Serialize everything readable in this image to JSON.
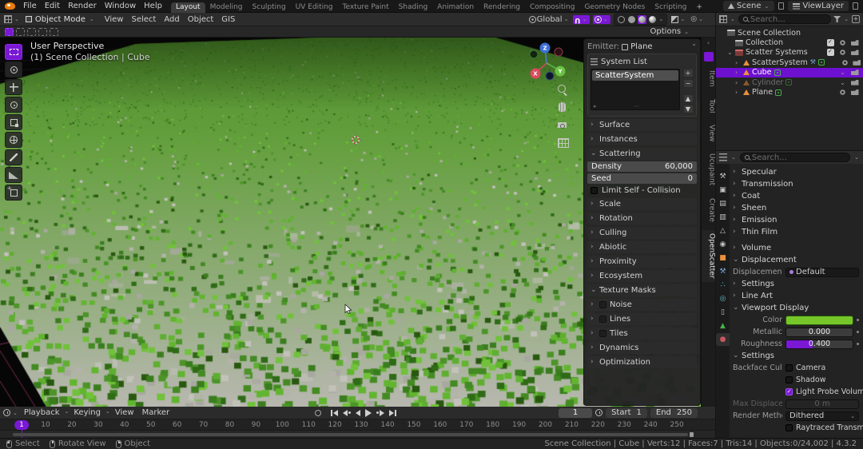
{
  "topbar": {
    "menus": [
      "File",
      "Edit",
      "Render",
      "Window",
      "Help"
    ],
    "workspaces": [
      "Layout",
      "Modeling",
      "Sculpting",
      "UV Editing",
      "Texture Paint",
      "Shading",
      "Animation",
      "Rendering",
      "Compositing",
      "Geometry Nodes",
      "Scripting"
    ],
    "active_workspace": "Layout",
    "add_workspace": "+",
    "scene_label": "Scene",
    "viewlayer_label": "ViewLayer"
  },
  "viewport": {
    "header": {
      "mode": "Object Mode",
      "menus": [
        "View",
        "Select",
        "Add",
        "Object",
        "GIS"
      ],
      "orientation": "Global"
    },
    "tool_settings": {
      "options_label": "Options",
      "select_modes": [
        "select-mode-new",
        "select-mode-extend",
        "select-mode-subtract",
        "select-mode-invert",
        "select-mode-intersect"
      ]
    },
    "overlay": {
      "line1": "User Perspective",
      "line2": "(1) Scene Collection | Cube"
    },
    "tools": [
      "select-box",
      "cursor",
      "move",
      "rotate",
      "scale",
      "transform",
      "annotate",
      "measure",
      "add-cube"
    ],
    "gizmo_axes": [
      "X",
      "Y",
      "Z"
    ],
    "sidebar_tabs": [
      "Item",
      "Tool",
      "View",
      "Ucupaint",
      "Create",
      "OpenScatter"
    ],
    "active_sidebar_tab": "OpenScatter",
    "field_palette": {
      "greens": [
        "#3a7d1e",
        "#4c9428",
        "#5fae31",
        "#70c23a",
        "#438a22",
        "#61b52f",
        "#2f6b16"
      ],
      "grays": [
        "#b3b3aa",
        "#c2c2ba",
        "#a8a8a0"
      ],
      "sky": "#060606",
      "ground_top": "#4f8f2a",
      "ground_mid": "#66a040",
      "ground_bottom": "#b8b8b0"
    }
  },
  "scatter_panel": {
    "emitter_label": "Emitter:",
    "emitter_value": "Plane",
    "system_list_title": "System List",
    "systems": [
      "ScatterSystem"
    ],
    "selected_system": "ScatterSystem",
    "rows": [
      {
        "type": "section",
        "label": "Surface"
      },
      {
        "type": "section",
        "label": "Instances"
      },
      {
        "type": "section_open",
        "label": "Scattering"
      },
      {
        "type": "slider",
        "label": "Density",
        "value": "60,000"
      },
      {
        "type": "slider",
        "label": "Seed",
        "value": "0"
      },
      {
        "type": "check",
        "label": "Limit Self - Collision",
        "checked": false
      },
      {
        "type": "section",
        "label": "Scale"
      },
      {
        "type": "section",
        "label": "Rotation"
      },
      {
        "type": "section",
        "label": "Culling"
      },
      {
        "type": "section",
        "label": "Abiotic"
      },
      {
        "type": "section",
        "label": "Proximity"
      },
      {
        "type": "section",
        "label": "Ecosystem"
      },
      {
        "type": "section_open",
        "label": "Texture Masks"
      },
      {
        "type": "subcheck",
        "label": "Noise",
        "checked": false
      },
      {
        "type": "subcheck",
        "label": "Lines",
        "checked": false
      },
      {
        "type": "subcheck",
        "label": "Tiles",
        "checked": false
      },
      {
        "type": "section",
        "label": "Dynamics"
      },
      {
        "type": "section",
        "label": "Optimization"
      }
    ]
  },
  "outliner": {
    "search_placeholder": "Search...",
    "rows": [
      {
        "label": "Scene Collection",
        "icon": "scene-collection",
        "depth": 0,
        "right": []
      },
      {
        "label": "Collection",
        "icon": "collection",
        "depth": 1,
        "right": [
          "check",
          "eye",
          "camera"
        ]
      },
      {
        "label": "Scatter Systems",
        "icon": "collection-red",
        "depth": 1,
        "caret": "open",
        "right": [
          "check",
          "eye",
          "camera"
        ]
      },
      {
        "label": "ScatterSystem",
        "icon": "mesh",
        "depth": 2,
        "caret": "closed",
        "extras": [
          "wrench",
          "nodes"
        ],
        "right": [
          "eye",
          "camera"
        ]
      },
      {
        "label": "Cube",
        "icon": "mesh",
        "depth": 2,
        "caret": "closed",
        "extras": [
          "nodes"
        ],
        "selected": true,
        "right": [
          "chevron",
          "camera"
        ]
      },
      {
        "label": "Cylinder",
        "icon": "mesh",
        "depth": 2,
        "caret": "closed",
        "extras": [
          "nodes"
        ],
        "dim": true,
        "right": [
          "chevron",
          "camera"
        ]
      },
      {
        "label": "Plane",
        "icon": "mesh",
        "depth": 2,
        "caret": "closed",
        "extras": [
          "nodes"
        ],
        "right": [
          "eye",
          "camera"
        ]
      }
    ]
  },
  "properties": {
    "search_placeholder": "Search...",
    "tabs": [
      "tool",
      "render",
      "output",
      "view-layer",
      "scene",
      "world",
      "object",
      "modifiers",
      "particles",
      "physics",
      "constraints",
      "object-data",
      "material"
    ],
    "active_tab": "material",
    "rows": [
      {
        "type": "section",
        "label": "Specular"
      },
      {
        "type": "section",
        "label": "Transmission"
      },
      {
        "type": "section",
        "label": "Coat"
      },
      {
        "type": "section",
        "label": "Sheen"
      },
      {
        "type": "section",
        "label": "Emission"
      },
      {
        "type": "section",
        "label": "Thin Film"
      },
      {
        "type": "section",
        "label": "Volume",
        "gap": true
      },
      {
        "type": "section_open",
        "label": "Displacement"
      },
      {
        "type": "field",
        "label": "Displacement",
        "value": "Default",
        "dot": true
      },
      {
        "type": "section",
        "label": "Settings"
      },
      {
        "type": "section",
        "label": "Line Art"
      },
      {
        "type": "section_open",
        "label": "Viewport Display"
      },
      {
        "type": "color",
        "label": "Color",
        "value": "#76c62a"
      },
      {
        "type": "slider",
        "label": "Metallic",
        "value": "0.000",
        "fill": 0
      },
      {
        "type": "slider",
        "label": "Roughness",
        "value": "0.400",
        "fill": 0.4
      },
      {
        "type": "section_open",
        "label": "Settings"
      },
      {
        "type": "checkrow",
        "label": "Backface Culling",
        "check": "Camera",
        "checked": false
      },
      {
        "type": "checkrow",
        "label": "",
        "check": "Shadow",
        "checked": false
      },
      {
        "type": "checkrow",
        "label": "",
        "check": "Light Probe Volume",
        "checked": true
      },
      {
        "type": "field_dim",
        "label": "Max Displacem...",
        "value": "0 m"
      },
      {
        "type": "dropdown",
        "label": "Render Method",
        "value": "Dithered"
      },
      {
        "type": "checkrow",
        "label": "",
        "check": "Raytraced Transmis...",
        "checked": false
      }
    ]
  },
  "timeline": {
    "menus": [
      "Playback",
      "Keying",
      "View",
      "Marker"
    ],
    "current_frame": "1",
    "start_label": "Start",
    "start_value": "1",
    "end_label": "End",
    "end_value": "250",
    "ticks": [
      "10",
      "20",
      "30",
      "40",
      "50",
      "60",
      "70",
      "80",
      "90",
      "100",
      "110",
      "120",
      "130",
      "140",
      "150",
      "160",
      "170",
      "180",
      "190",
      "200",
      "210",
      "220",
      "230",
      "240",
      "250"
    ]
  },
  "statusbar": {
    "hints": [
      {
        "button": "left",
        "label": "Select"
      },
      {
        "button": "middle",
        "label": "Rotate View"
      },
      {
        "button": "right",
        "label": "Object"
      }
    ],
    "stats": "Scene Collection | Cube | Verts:12 | Faces:7 | Tris:14 | Objects:0/24,002 | 4.3.2"
  },
  "colors": {
    "accent": "#7a18d5",
    "viewport_display_color": "#76c62a"
  }
}
